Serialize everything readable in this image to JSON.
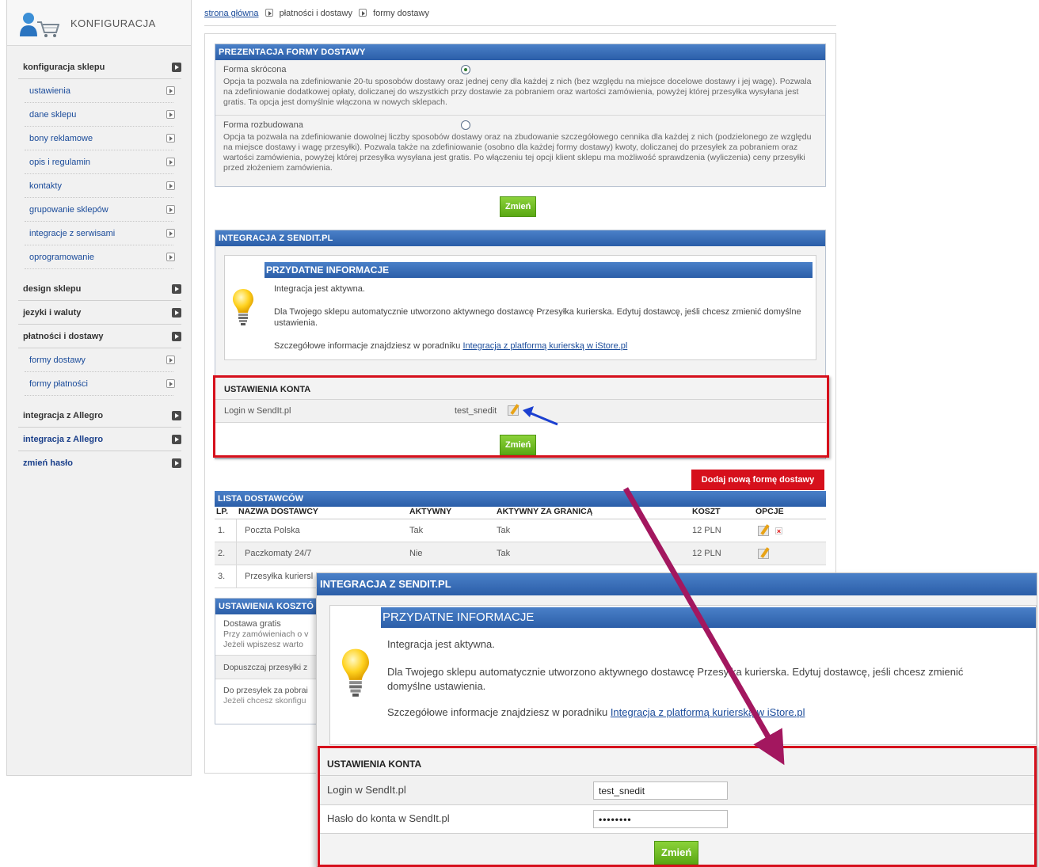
{
  "sidebar": {
    "title": "KONFIGURACJA",
    "groups": [
      {
        "label": "konfiguracja sklepu"
      },
      {
        "label": "design sklepu"
      },
      {
        "label": "jezyki i waluty"
      },
      {
        "label": "płatności i dostawy"
      },
      {
        "label": "integracja z Allegro"
      },
      {
        "label": "integracja z Allegro"
      },
      {
        "label": "zmień hasło"
      }
    ],
    "config_items": [
      "ustawienia",
      "dane sklepu",
      "bony reklamowe",
      "opis i regulamin",
      "kontakty",
      "grupowanie sklepów",
      "integracje z serwisami",
      "oprogramowanie"
    ],
    "payment_items": [
      "formy dostawy",
      "formy płatności"
    ]
  },
  "breadcrumb": {
    "home": "strona główna",
    "level1": "płatności i dostawy",
    "level2": "formy dostawy"
  },
  "presentation": {
    "title": "PREZENTACJA FORMY DOSTAWY",
    "short_title": "Forma skrócona",
    "short_desc": "Opcja ta pozwala na zdefiniowanie 20-tu sposobów dostawy oraz jednej ceny dla każdej z nich (bez względu na miejsce docelowe dostawy i jej wagę). Pozwala na zdefiniowanie dodatkowej opłaty, doliczanej do wszystkich przy dostawie za pobraniem oraz wartości zamówienia, powyżej której przesyłka wysyłana jest gratis. Ta opcja jest domyślnie włączona w nowych sklepach.",
    "extended_title": "Forma rozbudowana",
    "extended_desc": "Opcja ta pozwala na zdefiniowanie dowolnej liczby sposobów dostawy oraz na zbudowanie szczegółowego cennika dla każdej z nich (podzielonego ze względu na miejsce dostawy i wagę przesyłki). Pozwala także na zdefiniowanie (osobno dla każdej formy dostawy) kwoty, doliczanej do przesyłek za pobraniem oraz wartości zamówienia, powyżej której przesyłka wysyłana jest gratis. Po włączeniu tej opcji klient sklepu ma możliwość sprawdzenia (wyliczenia) ceny przesyłki przed złożeniem zamówienia.",
    "button": "Zmień"
  },
  "sendit": {
    "title": "INTEGRACJA Z SENDIT.PL",
    "info_title": "PRZYDATNE INFORMACJE",
    "line1": "Integracja jest aktywna.",
    "line2": "Dla Twojego sklepu automatycznie utworzono aktywnego dostawcę Przesyłka kurierska. Edytuj dostawcę, jeśli chcesz zmienić domyślne ustawienia.",
    "line3_prefix": "Szczegółowe informacje znajdziesz w poradniku ",
    "line3_link": "Integracja z platformą kurierską w iStore.pl",
    "account_title": "USTAWIENIA KONTA",
    "login_label": "Login w SendIt.pl",
    "login_value": "test_snedit",
    "button": "Zmień"
  },
  "add_button": "Dodaj nową formę dostawy",
  "providers": {
    "title": "LISTA DOSTAWCÓW",
    "columns": [
      "LP.",
      "NAZWA DOSTAWCY",
      "AKTYWNY",
      "AKTYWNY ZA GRANICĄ",
      "KOSZT",
      "OPCJE"
    ],
    "rows": [
      {
        "lp": "1.",
        "name": "Poczta Polska",
        "active": "Tak",
        "abroad": "Tak",
        "cost": "12 PLN"
      },
      {
        "lp": "2.",
        "name": "Paczkomaty 24/7",
        "active": "Nie",
        "abroad": "Tak",
        "cost": "12 PLN"
      },
      {
        "lp": "3.",
        "name": "Przesyłka kuriersl",
        "active": "",
        "abroad": "",
        "cost": ""
      }
    ]
  },
  "costs": {
    "title": "USTAWIENIA KOSZTÓ",
    "free_title": "Dostawa gratis",
    "free_l1": "Przy zamówieniach o v",
    "free_l2": "Jeżeli wpiszesz warto",
    "row2": "Dopuszczaj przesyłki z",
    "row3_l1": "Do przesyłek za pobrai",
    "row3_l2": "Jeżeli chcesz skonfigu"
  },
  "zoom": {
    "title": "INTEGRACJA Z SENDIT.PL",
    "info_title": "PRZYDATNE INFORMACJE",
    "line1": "Integracja jest aktywna.",
    "line2a": "Dla Twojego sklepu automatycznie utworzono aktywnego dostawcę Przesyłka kurierska. Edytuj dostawcę, jeśli chcesz zmienić",
    "line2b": "domyślne ustawienia.",
    "line3_prefix": "Szczegółowe informacje znajdziesz w poradniku ",
    "line3_link": "Integracja z platformą kurierską w iStore.pl",
    "account_title": "USTAWIENIA KONTA",
    "login_label": "Login w SendIt.pl",
    "login_value": "test_snedit",
    "password_label": "Hasło do konta w SendIt.pl",
    "password_value": "••••••••",
    "button": "Zmień"
  },
  "colors": {
    "header_blue": "#2b5ea8",
    "button_green": "#6bbb1f",
    "highlight_red": "#d6101c",
    "arrow_purple": "#a3175f",
    "pointer_blue": "#1b3fd0"
  }
}
